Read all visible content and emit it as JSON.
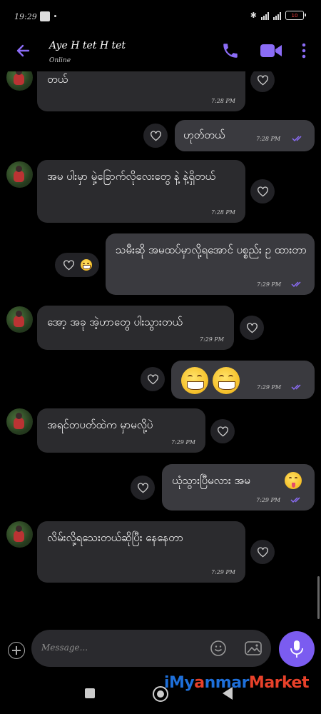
{
  "status_bar": {
    "time": "19:29",
    "battery": "10"
  },
  "contact": {
    "name": "Aye H tet H tet",
    "status": "Online"
  },
  "colors": {
    "accent": "#7b5cf0",
    "incoming": "#2b2b2e",
    "outgoing": "#3a3a3f"
  },
  "messages": [
    {
      "id": "m1",
      "dir": "in",
      "text": "တယ်",
      "time": "7:28 PM"
    },
    {
      "id": "m2",
      "dir": "out",
      "text": "ဟုတ်တယ်",
      "time": "7:28 PM"
    },
    {
      "id": "m3",
      "dir": "in",
      "text": "အမ ပါးမှာ မှဲ့ခြောက်လိုလေးတွေ နဲ့ နဲ့ရှိတယ်",
      "time": "7:28 PM"
    },
    {
      "id": "m4",
      "dir": "out",
      "text": "သမီးဆို အမထပ်မှာလို့ရအောင် ပစ္စည်း ဥ ထားတာ",
      "time": "7:29 PM"
    },
    {
      "id": "m5",
      "dir": "in",
      "text": "အော့ အခု အဲ့ဟာတွေ ပါးသွားတယ်",
      "time": "7:29 PM"
    },
    {
      "id": "m6",
      "dir": "out",
      "text": "",
      "time": "7:29 PM"
    },
    {
      "id": "m7",
      "dir": "in",
      "text": "အရင်တပတ်ထဲက မှာမလို့ပဲ",
      "time": "7:29 PM"
    },
    {
      "id": "m8",
      "dir": "out",
      "text": "ယုံသွားပြီမလား အမ",
      "time": "7:29 PM"
    },
    {
      "id": "m9",
      "dir": "in",
      "text": "လိမ်းလို့ရသေးတယ်ဆိုပြီး နေနေတာ",
      "time": "7:29 PM"
    }
  ],
  "composer": {
    "placeholder": "Message..."
  },
  "watermark": {
    "p1": "iMy",
    "p2": "a",
    "p3": "nmar",
    "p4": "Market"
  }
}
